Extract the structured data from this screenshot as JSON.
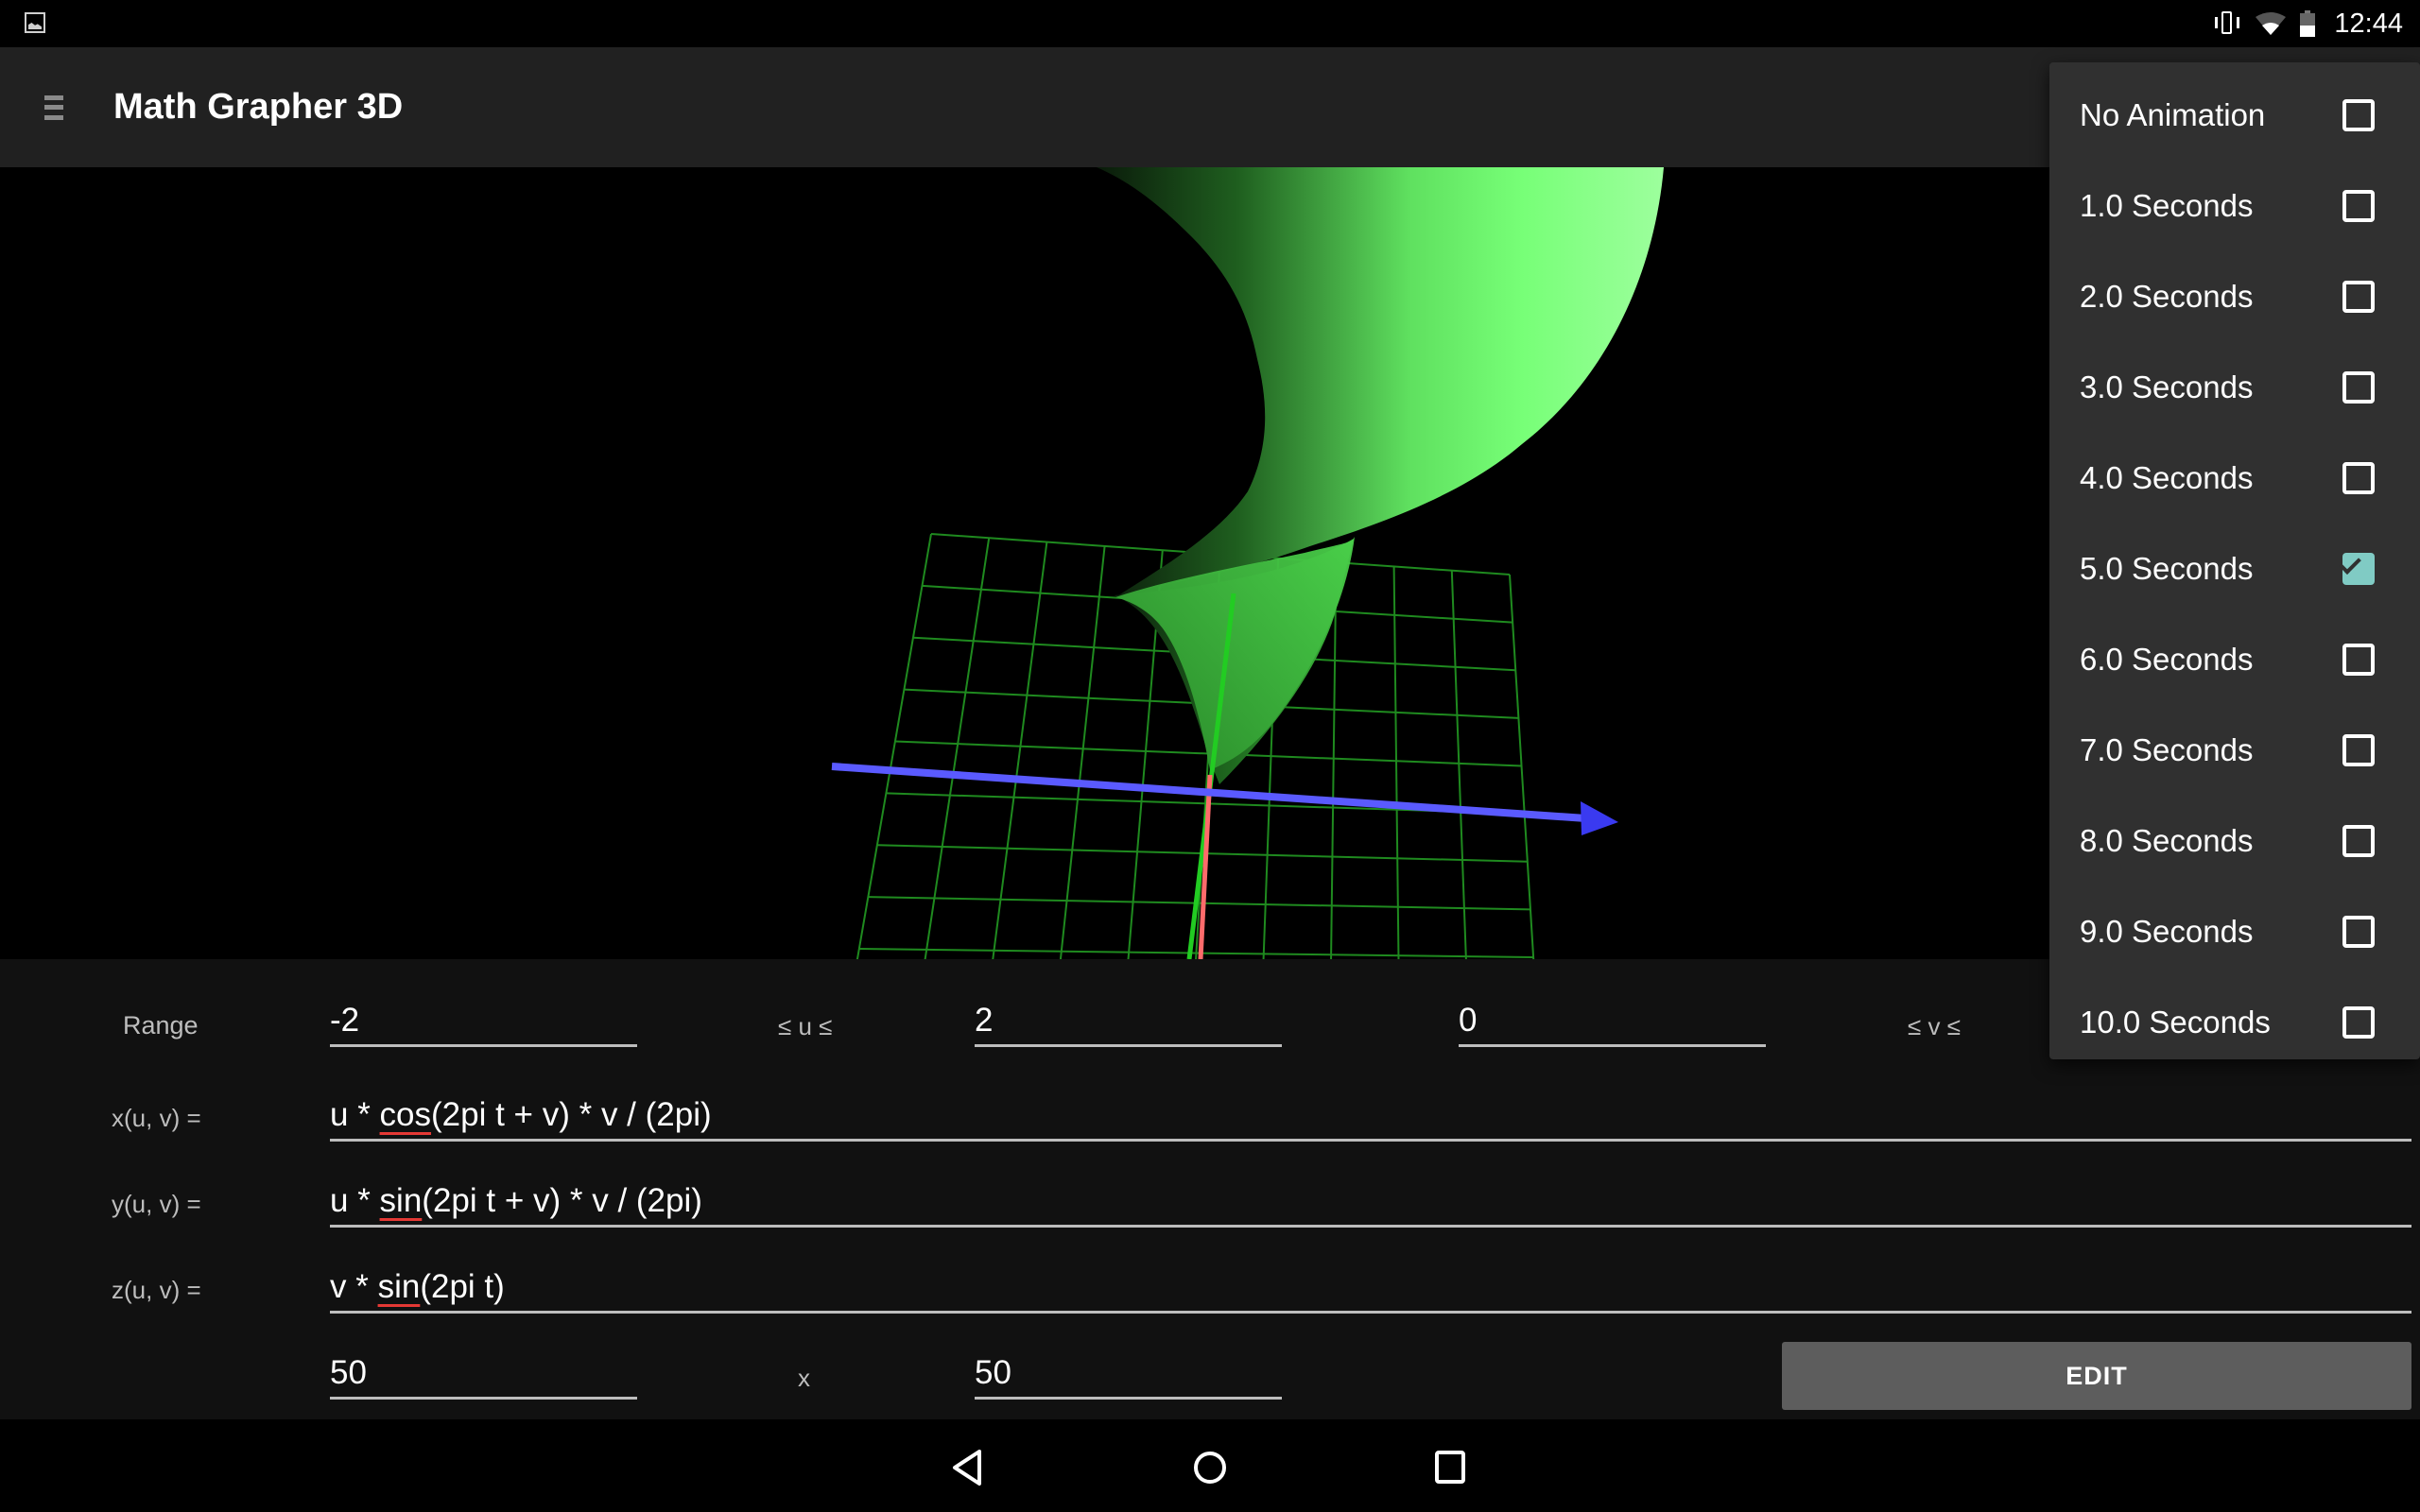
{
  "status_bar": {
    "left_icon": "image-notification-icon",
    "icons": [
      "vibrate-icon",
      "wifi-icon",
      "battery-icon"
    ],
    "time": "12:44"
  },
  "toolbar": {
    "menu_icon": "hamburger-menu-icon",
    "title": "Math Grapher 3D"
  },
  "graph": {
    "surface_color": "#66ff66",
    "grid_color": "#1f8a1f",
    "axis_colors": {
      "x": "#ff6b6b",
      "y": "#5555ff",
      "z": "#22cc22"
    }
  },
  "range": {
    "label": "Range",
    "u_min": "-2",
    "u_separator": "≤ u ≤",
    "u_max": "2",
    "v_min": "0",
    "v_separator": "≤ v ≤"
  },
  "functions": [
    {
      "label": "x(u, v) =",
      "parts": [
        "u * ",
        "cos",
        "(2pi t + v) * v / (2pi)"
      ]
    },
    {
      "label": "y(u, v) =",
      "parts": [
        "u * ",
        "sin",
        "(2pi t + v) * v / (2pi)"
      ]
    },
    {
      "label": "z(u, v) =",
      "parts": [
        "v * ",
        "sin",
        "(2pi t)"
      ]
    }
  ],
  "resolution": {
    "u_steps": "50",
    "separator": "x",
    "v_steps": "50"
  },
  "edit_button": "EDIT",
  "nav": {
    "back": "back-icon",
    "home": "home-icon",
    "recents": "recents-icon"
  },
  "animation_menu": {
    "items": [
      {
        "label": "No Animation",
        "checked": false
      },
      {
        "label": "1.0 Seconds",
        "checked": false
      },
      {
        "label": "2.0 Seconds",
        "checked": false
      },
      {
        "label": "3.0 Seconds",
        "checked": false
      },
      {
        "label": "4.0 Seconds",
        "checked": false
      },
      {
        "label": "5.0 Seconds",
        "checked": true
      },
      {
        "label": "6.0 Seconds",
        "checked": false
      },
      {
        "label": "7.0 Seconds",
        "checked": false
      },
      {
        "label": "8.0 Seconds",
        "checked": false
      },
      {
        "label": "9.0 Seconds",
        "checked": false
      },
      {
        "label": "10.0 Seconds",
        "checked": false
      }
    ],
    "accent_color": "#80cbc4"
  }
}
